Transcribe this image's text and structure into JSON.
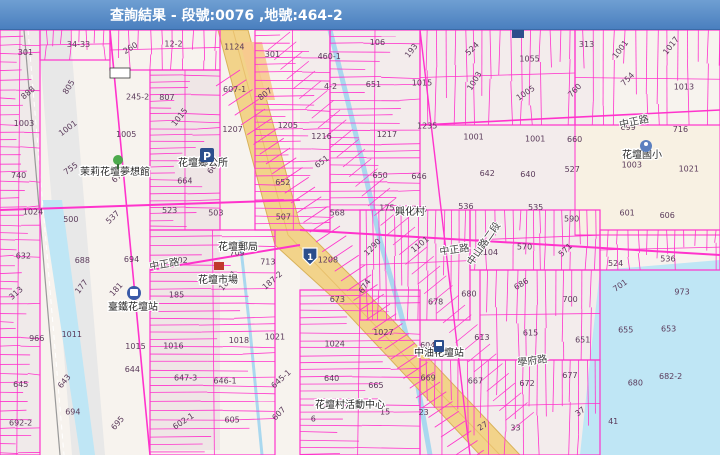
{
  "header": {
    "title": "查詢結果 - 段號:0076 ,地號:464-2"
  },
  "colors": {
    "parcel_line": "#ff33cc",
    "water": "#bfe6f5",
    "main_road": "#f2d38a",
    "header": "#5a8cc8"
  },
  "places": [
    {
      "id": "jasmine",
      "text": "茉莉花壇夢想館"
    },
    {
      "id": "township",
      "text": "花壇鄉公所"
    },
    {
      "id": "elementary",
      "text": "花壇國小"
    },
    {
      "id": "post_office",
      "text": "花壇郵局"
    },
    {
      "id": "xinglixin",
      "text": "興化村"
    },
    {
      "id": "station",
      "text": "臺鐵花壇站"
    },
    {
      "id": "market",
      "text": "花壇市場"
    },
    {
      "id": "cpc",
      "text": "中油花壇站"
    },
    {
      "id": "activity",
      "text": "花壇村活動中心"
    },
    {
      "id": "temple",
      "text": "花壇"
    }
  ],
  "roads": [
    {
      "id": "zhongzheng1",
      "text": "中正路"
    },
    {
      "id": "zhongzheng2",
      "text": "中正路"
    },
    {
      "id": "zhongzheng3",
      "text": "中正路"
    },
    {
      "id": "zhongshan",
      "text": "中山路二段"
    },
    {
      "id": "huanyuan",
      "text": "學府路"
    }
  ],
  "route_shield": "1",
  "parcel_labels": [
    "301",
    "34-33",
    "260",
    "12-2",
    "1124",
    "301",
    "460-1",
    "106",
    "193",
    "524",
    "1055",
    "313",
    "1001",
    "1017",
    "888",
    "805",
    "245-2",
    "807",
    "607-1",
    "807",
    "4-2",
    "651",
    "1015",
    "1003",
    "1005",
    "760",
    "754",
    "1013",
    "1003",
    "1001",
    "1005",
    "1015",
    "1207",
    "1205",
    "1216",
    "1217",
    "1235",
    "1001",
    "1001",
    "660",
    "699",
    "716",
    "740",
    "755",
    "675",
    "664",
    "662",
    "652",
    "651",
    "650",
    "646",
    "642",
    "640",
    "527",
    "1003",
    "1021",
    "1024",
    "500",
    "537",
    "523",
    "503",
    "507",
    "568",
    "175",
    "565",
    "536",
    "535",
    "590",
    "601",
    "606",
    "632",
    "688",
    "694",
    "702",
    "709",
    "713",
    "1208",
    "1290",
    "1101",
    "1104",
    "570",
    "571",
    "524",
    "536",
    "313",
    "177",
    "181",
    "185",
    "187-1",
    "187-2",
    "673",
    "674",
    "678",
    "680",
    "686",
    "700",
    "701",
    "973",
    "966",
    "1011",
    "1015",
    "1016",
    "1018",
    "1021",
    "1024",
    "1027",
    "604",
    "613",
    "615",
    "651",
    "655",
    "653",
    "645",
    "643",
    "644",
    "647-3",
    "646-1",
    "645-1",
    "640",
    "665",
    "669",
    "667",
    "672",
    "677",
    "680",
    "682-2",
    "692-2",
    "694",
    "695",
    "602-1",
    "605",
    "607",
    "6",
    "15",
    "23",
    "27",
    "33",
    "37",
    "41"
  ]
}
